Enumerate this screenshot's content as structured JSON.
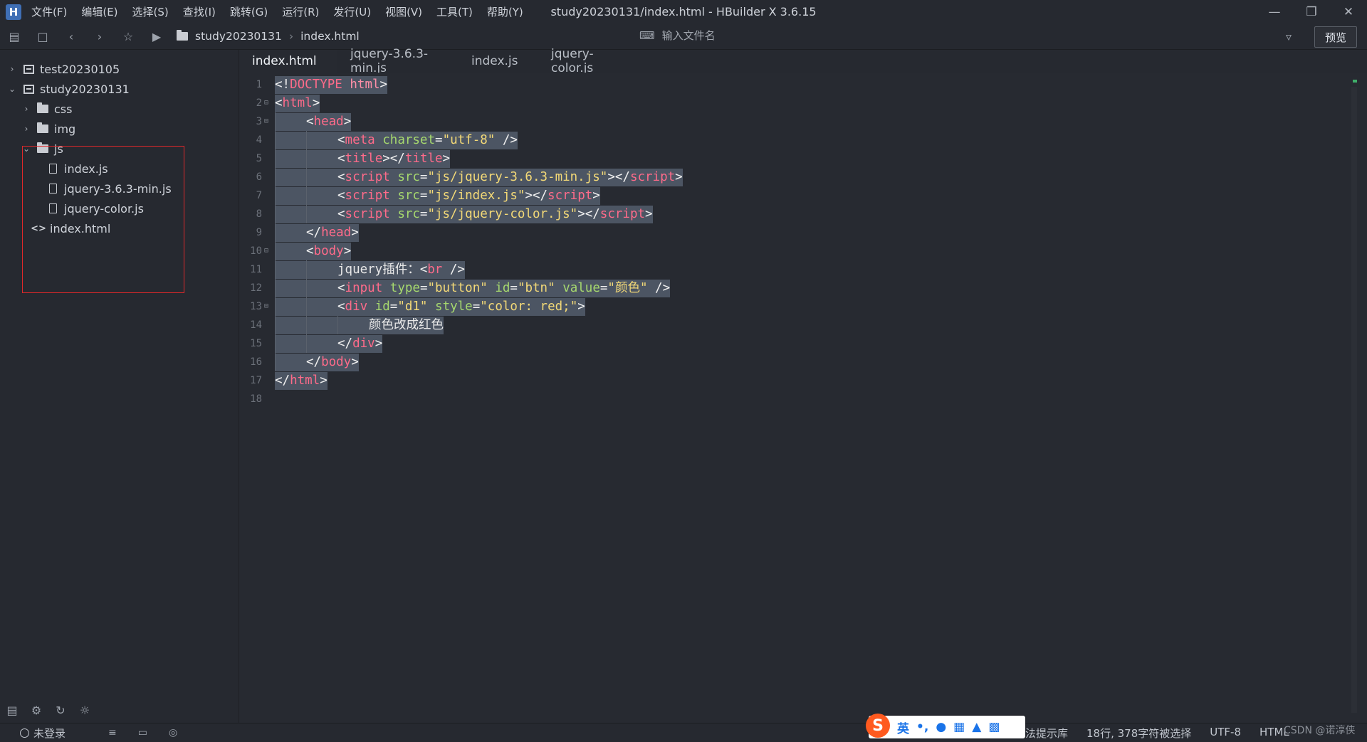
{
  "app": {
    "title": "study20230131/index.html - HBuilder X 3.6.15",
    "logo": "H",
    "menu": [
      "文件(F)",
      "编辑(E)",
      "选择(S)",
      "查找(I)",
      "跳转(G)",
      "运行(R)",
      "发行(U)",
      "视图(V)",
      "工具(T)",
      "帮助(Y)"
    ]
  },
  "toolbar": {
    "breadcrumb": [
      "study20230131",
      "index.html"
    ],
    "search_placeholder": "输入文件名",
    "preview_label": "预览"
  },
  "sidebar": {
    "tree": [
      {
        "label": "test20230105",
        "kind": "project",
        "expanded": false
      },
      {
        "label": "study20230131",
        "kind": "project",
        "expanded": true
      },
      {
        "label": "css",
        "kind": "folder",
        "expanded": false
      },
      {
        "label": "img",
        "kind": "folder",
        "expanded": false
      },
      {
        "label": "js",
        "kind": "folder",
        "expanded": true
      },
      {
        "label": "index.js",
        "kind": "file"
      },
      {
        "label": "jquery-3.6.3-min.js",
        "kind": "file"
      },
      {
        "label": "jquery-color.js",
        "kind": "file"
      },
      {
        "label": "index.html",
        "kind": "html"
      }
    ],
    "highlight_color": "#e0282a"
  },
  "tabs": [
    {
      "label": "index.html",
      "active": true
    },
    {
      "label": "jquery-3.6.3-min.js",
      "active": false
    },
    {
      "label": "index.js",
      "active": false
    },
    {
      "label": "jquery-color.js",
      "active": false
    }
  ],
  "editor": {
    "line_numbers": [
      "1",
      "2",
      "3",
      "4",
      "5",
      "6",
      "7",
      "8",
      "9",
      "10",
      "11",
      "12",
      "13",
      "14",
      "15",
      "16",
      "17",
      "18"
    ],
    "fold_markers": {
      "2": "⊟",
      "3": "⊟",
      "10": "⊟",
      "13": "⊟"
    },
    "lines": [
      {
        "indent": 0,
        "tokens": [
          [
            "p",
            "<!"
          ],
          [
            "doc",
            "DOCTYPE"
          ],
          [
            "p",
            " "
          ],
          [
            "kw",
            "html"
          ],
          [
            "p",
            ">"
          ]
        ]
      },
      {
        "indent": 0,
        "tokens": [
          [
            "p",
            "<"
          ],
          [
            "tag",
            "html"
          ],
          [
            "p",
            ">"
          ]
        ]
      },
      {
        "indent": 1,
        "tokens": [
          [
            "p",
            "<"
          ],
          [
            "tag",
            "head"
          ],
          [
            "p",
            ">"
          ]
        ]
      },
      {
        "indent": 2,
        "tokens": [
          [
            "p",
            "<"
          ],
          [
            "tag",
            "meta"
          ],
          [
            "p",
            " "
          ],
          [
            "attr",
            "charset"
          ],
          [
            "p",
            "="
          ],
          [
            "str",
            "\"utf-8\""
          ],
          [
            "p",
            " />"
          ]
        ]
      },
      {
        "indent": 2,
        "tokens": [
          [
            "p",
            "<"
          ],
          [
            "tag",
            "title"
          ],
          [
            "p",
            "></"
          ],
          [
            "tag",
            "title"
          ],
          [
            "p",
            ">"
          ]
        ]
      },
      {
        "indent": 2,
        "tokens": [
          [
            "p",
            "<"
          ],
          [
            "tag",
            "script"
          ],
          [
            "p",
            " "
          ],
          [
            "attr",
            "src"
          ],
          [
            "p",
            "="
          ],
          [
            "str",
            "\"js/jquery-3.6.3-min.js\""
          ],
          [
            "p",
            "></"
          ],
          [
            "tag",
            "script"
          ],
          [
            "p",
            ">"
          ]
        ]
      },
      {
        "indent": 2,
        "tokens": [
          [
            "p",
            "<"
          ],
          [
            "tag",
            "script"
          ],
          [
            "p",
            " "
          ],
          [
            "attr",
            "src"
          ],
          [
            "p",
            "="
          ],
          [
            "str",
            "\"js/index.js\""
          ],
          [
            "p",
            "></"
          ],
          [
            "tag",
            "script"
          ],
          [
            "p",
            ">"
          ]
        ]
      },
      {
        "indent": 2,
        "tokens": [
          [
            "p",
            "<"
          ],
          [
            "tag",
            "script"
          ],
          [
            "p",
            " "
          ],
          [
            "attr",
            "src"
          ],
          [
            "p",
            "="
          ],
          [
            "str",
            "\"js/jquery-color.js\""
          ],
          [
            "p",
            "></"
          ],
          [
            "tag",
            "script"
          ],
          [
            "p",
            ">"
          ]
        ]
      },
      {
        "indent": 1,
        "tokens": [
          [
            "p",
            "</"
          ],
          [
            "tag",
            "head"
          ],
          [
            "p",
            ">"
          ]
        ]
      },
      {
        "indent": 1,
        "tokens": [
          [
            "p",
            "<"
          ],
          [
            "tag",
            "body"
          ],
          [
            "p",
            ">"
          ]
        ]
      },
      {
        "indent": 2,
        "tokens": [
          [
            "txt",
            "jquery插件："
          ],
          [
            "p",
            "<"
          ],
          [
            "tag",
            "br"
          ],
          [
            "p",
            " />"
          ]
        ]
      },
      {
        "indent": 2,
        "tokens": [
          [
            "p",
            "<"
          ],
          [
            "tag",
            "input"
          ],
          [
            "p",
            " "
          ],
          [
            "attr",
            "type"
          ],
          [
            "p",
            "="
          ],
          [
            "str",
            "\"button\""
          ],
          [
            "p",
            " "
          ],
          [
            "attr",
            "id"
          ],
          [
            "p",
            "="
          ],
          [
            "str",
            "\"btn\""
          ],
          [
            "p",
            " "
          ],
          [
            "attr",
            "value"
          ],
          [
            "p",
            "="
          ],
          [
            "str",
            "\"颜色\""
          ],
          [
            "p",
            " />"
          ]
        ]
      },
      {
        "indent": 2,
        "tokens": [
          [
            "p",
            "<"
          ],
          [
            "tag",
            "div"
          ],
          [
            "p",
            " "
          ],
          [
            "attr",
            "id"
          ],
          [
            "p",
            "="
          ],
          [
            "str",
            "\"d1\""
          ],
          [
            "p",
            " "
          ],
          [
            "attr",
            "style"
          ],
          [
            "p",
            "="
          ],
          [
            "str",
            "\"color: red;\""
          ],
          [
            "p",
            ">"
          ]
        ]
      },
      {
        "indent": 3,
        "tokens": [
          [
            "txt",
            "颜色改成红色"
          ]
        ]
      },
      {
        "indent": 2,
        "tokens": [
          [
            "p",
            "</"
          ],
          [
            "tag",
            "div"
          ],
          [
            "p",
            ">"
          ]
        ]
      },
      {
        "indent": 1,
        "tokens": [
          [
            "p",
            "</"
          ],
          [
            "tag",
            "body"
          ],
          [
            "p",
            ">"
          ]
        ]
      },
      {
        "indent": 0,
        "tokens": [
          [
            "p",
            "</"
          ],
          [
            "tag",
            "html"
          ],
          [
            "p",
            ">"
          ]
        ]
      },
      {
        "indent": 0,
        "tokens": []
      }
    ]
  },
  "statusbar": {
    "login_label": "未登录",
    "ime_lang": "英",
    "partial_hint": "法提示库",
    "selection_info": "18行, 378字符被选择",
    "encoding": "UTF-8",
    "language": "HTML"
  },
  "watermark": "CSDN @诺淳侠",
  "colors": {
    "background": "#272a31",
    "selection": "#4c5563",
    "tag": "#ff6b8a",
    "attribute": "#a6d86e",
    "string": "#f3d977"
  }
}
